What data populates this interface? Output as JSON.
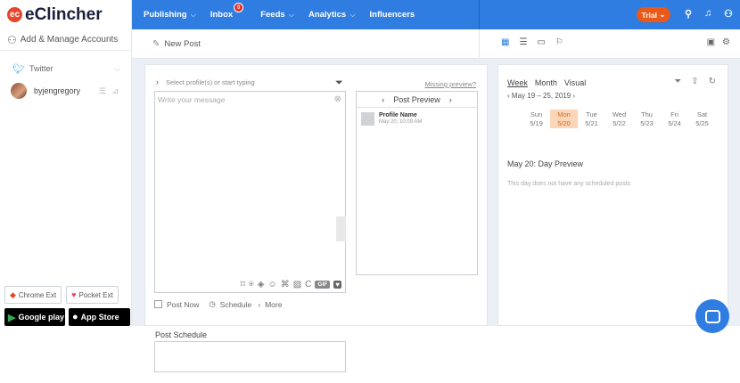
{
  "sidebar": {
    "logo": "eClincher",
    "add_manage": "Add & Manage Accounts",
    "network": "Twitter",
    "profile": "byjengregory",
    "ext_chrome": "Chrome Ext",
    "ext_pocket": "Pocket Ext",
    "store_google": "Google play",
    "store_apple": "App Store"
  },
  "nav": {
    "publishing": "Publishing",
    "inbox": "Inbox",
    "inbox_badge": "0",
    "feeds": "Feeds",
    "analytics": "Analytics",
    "influencers": "Influencers",
    "trial": "Trial"
  },
  "composer": {
    "new_post": "New Post",
    "select_placeholder": "Select profile(s) or start typing",
    "missing_preview": "Missing preview?",
    "message_placeholder": "Write your message",
    "preview_title": "Post Preview",
    "profile_name": "Profile Name",
    "profile_date": "May 20, 10:09 AM",
    "gif": "GIF",
    "post_now": "Post Now",
    "schedule": "Schedule",
    "more": "More",
    "schedule_label": "Post Schedule"
  },
  "calendar": {
    "tabs": [
      "Week",
      "Month",
      "Visual"
    ],
    "range": "May 19 – 25, 2019",
    "days": [
      {
        "name": "Sun",
        "date": "5/19"
      },
      {
        "name": "Mon",
        "date": "5/20"
      },
      {
        "name": "Tue",
        "date": "5/21"
      },
      {
        "name": "Wed",
        "date": "5/22"
      },
      {
        "name": "Thu",
        "date": "5/23"
      },
      {
        "name": "Fri",
        "date": "5/24"
      },
      {
        "name": "Sat",
        "date": "5/25"
      }
    ],
    "day_preview": "May 20: Day Preview",
    "no_posts": "This day does not have any scheduled posts"
  },
  "colors": {
    "brand_blue": "#2f7de1",
    "trial_orange": "#e8591a",
    "today_highlight": "#fbd6b8"
  }
}
